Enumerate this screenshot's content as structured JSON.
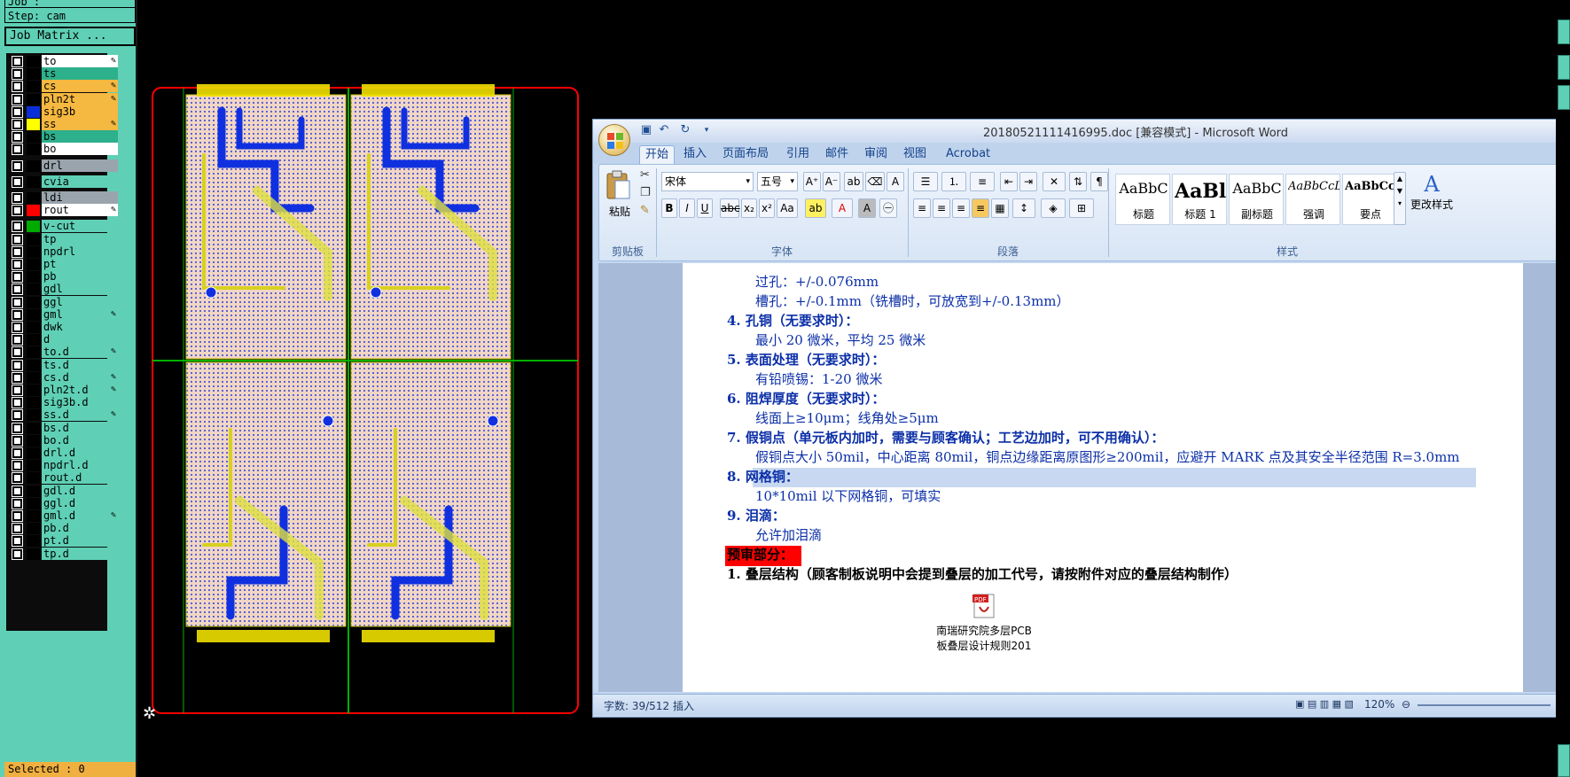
{
  "cam": {
    "job_text": "Job : ",
    "step_text": "Step: cam",
    "job_matrix_label": "Job Matrix ...",
    "selected_text": "Selected : 0",
    "layers": [
      {
        "name": "to",
        "color": "#ffffff",
        "swatch": "#000000",
        "pen": true
      },
      {
        "name": "ts",
        "color": "#2db08c",
        "swatch": "#000000",
        "pen": false
      },
      {
        "name": "cs",
        "color": "#f5b840",
        "swatch": "#000000",
        "pen": true
      },
      {
        "name": "pln2t",
        "color": "#f5b840",
        "swatch": "#000000",
        "pen": true
      },
      {
        "name": "sig3b",
        "color": "#f5b840",
        "swatch": "#0a2fd8",
        "pen": false
      },
      {
        "name": "ss",
        "color": "#f5b840",
        "swatch": "#ffff00",
        "pen": true
      },
      {
        "name": "bs",
        "color": "#2db08c",
        "swatch": "#000000",
        "pen": false
      },
      {
        "name": "bo",
        "color": "#ffffff",
        "swatch": "#000000",
        "pen": false
      },
      {
        "name": "drl",
        "color": "#9aa4ad",
        "swatch": "#000000",
        "pen": false
      },
      {
        "name": "cvia",
        "color": "#5fd0b5",
        "swatch": "#000000",
        "pen": false
      },
      {
        "name": "ldi",
        "color": "#9aa4ad",
        "swatch": "#000000",
        "pen": false
      },
      {
        "name": "rout",
        "color": "#ffffff",
        "swatch": "#ff0000",
        "pen": true
      },
      {
        "name": "v-cut",
        "color": "#5fd0b5",
        "swatch": "#00aa00",
        "pen": false
      },
      {
        "name": "tp",
        "color": "#5fd0b5",
        "swatch": "#000000",
        "pen": false
      },
      {
        "name": "npdrl",
        "color": "#5fd0b5",
        "swatch": "#000000",
        "pen": false
      },
      {
        "name": "pt",
        "color": "#5fd0b5",
        "swatch": "#000000",
        "pen": false
      },
      {
        "name": "pb",
        "color": "#5fd0b5",
        "swatch": "#000000",
        "pen": false
      },
      {
        "name": "gdl",
        "color": "#5fd0b5",
        "swatch": "#000000",
        "pen": false
      },
      {
        "name": "ggl",
        "color": "#5fd0b5",
        "swatch": "#000000",
        "pen": false
      },
      {
        "name": "gml",
        "color": "#5fd0b5",
        "swatch": "#000000",
        "pen": true
      },
      {
        "name": "dwk",
        "color": "#5fd0b5",
        "swatch": "#000000",
        "pen": false
      },
      {
        "name": "d",
        "color": "#5fd0b5",
        "swatch": "#000000",
        "pen": false
      },
      {
        "name": "to.d",
        "color": "#5fd0b5",
        "swatch": "#000000",
        "pen": true
      },
      {
        "name": "ts.d",
        "color": "#5fd0b5",
        "swatch": "#000000",
        "pen": false
      },
      {
        "name": "cs.d",
        "color": "#5fd0b5",
        "swatch": "#000000",
        "pen": true
      },
      {
        "name": "pln2t.d",
        "color": "#5fd0b5",
        "swatch": "#000000",
        "pen": true
      },
      {
        "name": "sig3b.d",
        "color": "#5fd0b5",
        "swatch": "#000000",
        "pen": false
      },
      {
        "name": "ss.d",
        "color": "#5fd0b5",
        "swatch": "#000000",
        "pen": true
      },
      {
        "name": "bs.d",
        "color": "#5fd0b5",
        "swatch": "#000000",
        "pen": false
      },
      {
        "name": "bo.d",
        "color": "#5fd0b5",
        "swatch": "#000000",
        "pen": false
      },
      {
        "name": "drl.d",
        "color": "#5fd0b5",
        "swatch": "#000000",
        "pen": false
      },
      {
        "name": "npdrl.d",
        "color": "#5fd0b5",
        "swatch": "#000000",
        "pen": false
      },
      {
        "name": "rout.d",
        "color": "#5fd0b5",
        "swatch": "#000000",
        "pen": false
      },
      {
        "name": "gdl.d",
        "color": "#5fd0b5",
        "swatch": "#000000",
        "pen": false
      },
      {
        "name": "ggl.d",
        "color": "#5fd0b5",
        "swatch": "#000000",
        "pen": false
      },
      {
        "name": "gml.d",
        "color": "#5fd0b5",
        "swatch": "#000000",
        "pen": true
      },
      {
        "name": "pb.d",
        "color": "#5fd0b5",
        "swatch": "#000000",
        "pen": false
      },
      {
        "name": "pt.d",
        "color": "#5fd0b5",
        "swatch": "#000000",
        "pen": false
      },
      {
        "name": "tp.d",
        "color": "#5fd0b5",
        "swatch": "#000000",
        "pen": false
      }
    ]
  },
  "word": {
    "title": "20180521111416995.doc [兼容模式] - Microsoft Word",
    "tabs": [
      "开始",
      "插入",
      "页面布局",
      "引用",
      "邮件",
      "审阅",
      "视图",
      "Acrobat"
    ],
    "font_name": "宋体",
    "font_size": "五号",
    "groups": {
      "clipboard": "剪贴板",
      "font": "字体",
      "paragraph": "段落",
      "styles": "样式"
    },
    "paste_label": "粘贴",
    "change_styles_label": "更改样式",
    "styles": [
      {
        "sample": "AaBbC",
        "name": "标题"
      },
      {
        "sample": "AaBl",
        "name": "标题 1"
      },
      {
        "sample": "AaBbC",
        "name": "副标题"
      },
      {
        "sample": "AaBbCcDc",
        "name": "强调"
      },
      {
        "sample": "AaBbCcD",
        "name": "要点"
      }
    ],
    "doc_lines": [
      {
        "text": "过孔：+/-0.076mm",
        "cls": "b",
        "indent": true
      },
      {
        "text": "槽孔：+/-0.1mm（铣槽时，可放宽到+/-0.13mm）",
        "cls": "b",
        "indent": true
      },
      {
        "text": "4. 孔铜（无要求时）：",
        "cls": "h",
        "indent": false
      },
      {
        "text": "最小 20 微米，平均 25 微米",
        "cls": "b",
        "indent": true
      },
      {
        "text": "5. 表面处理（无要求时）：",
        "cls": "h",
        "indent": false
      },
      {
        "text": "有铅喷锡：1-20 微米",
        "cls": "b",
        "indent": true
      },
      {
        "text": "6. 阻焊厚度（无要求时）：",
        "cls": "h",
        "indent": false
      },
      {
        "text": "线面上≥10μm；线角处≥5μm",
        "cls": "b",
        "indent": true
      },
      {
        "text": "7. 假铜点（单元板内加时，需要与顾客确认；工艺边加时，可不用确认）：",
        "cls": "h",
        "indent": false
      },
      {
        "text": "假铜点大小 50mil，中心距离 80mil，铜点边缘距离原图形≥200mil，应避开 MARK 点及其安全半径范围 R=3.0mm",
        "cls": "b",
        "indent": true
      },
      {
        "text": "8. 网格铜：",
        "cls": "h",
        "indent": false
      },
      {
        "text": "10*10mil 以下网格铜，可填实",
        "cls": "b",
        "indent": true
      },
      {
        "text": "9. 泪滴：",
        "cls": "h",
        "indent": false
      },
      {
        "text": "允许加泪滴",
        "cls": "b",
        "indent": true
      },
      {
        "text": "预审部分：",
        "cls": "k",
        "indent": false
      },
      {
        "text": "1. 叠层结构（顾客制板说明中会提到叠层的加工代号，请按附件对应的叠层结构制作）",
        "cls": "k",
        "indent": false
      }
    ],
    "attachment_line1": "南瑞研究院多层PCB",
    "attachment_line2": "板叠层设计规则201",
    "status": {
      "words": "字数: 39/512",
      "mode": "插入",
      "zoom": "120%"
    }
  }
}
